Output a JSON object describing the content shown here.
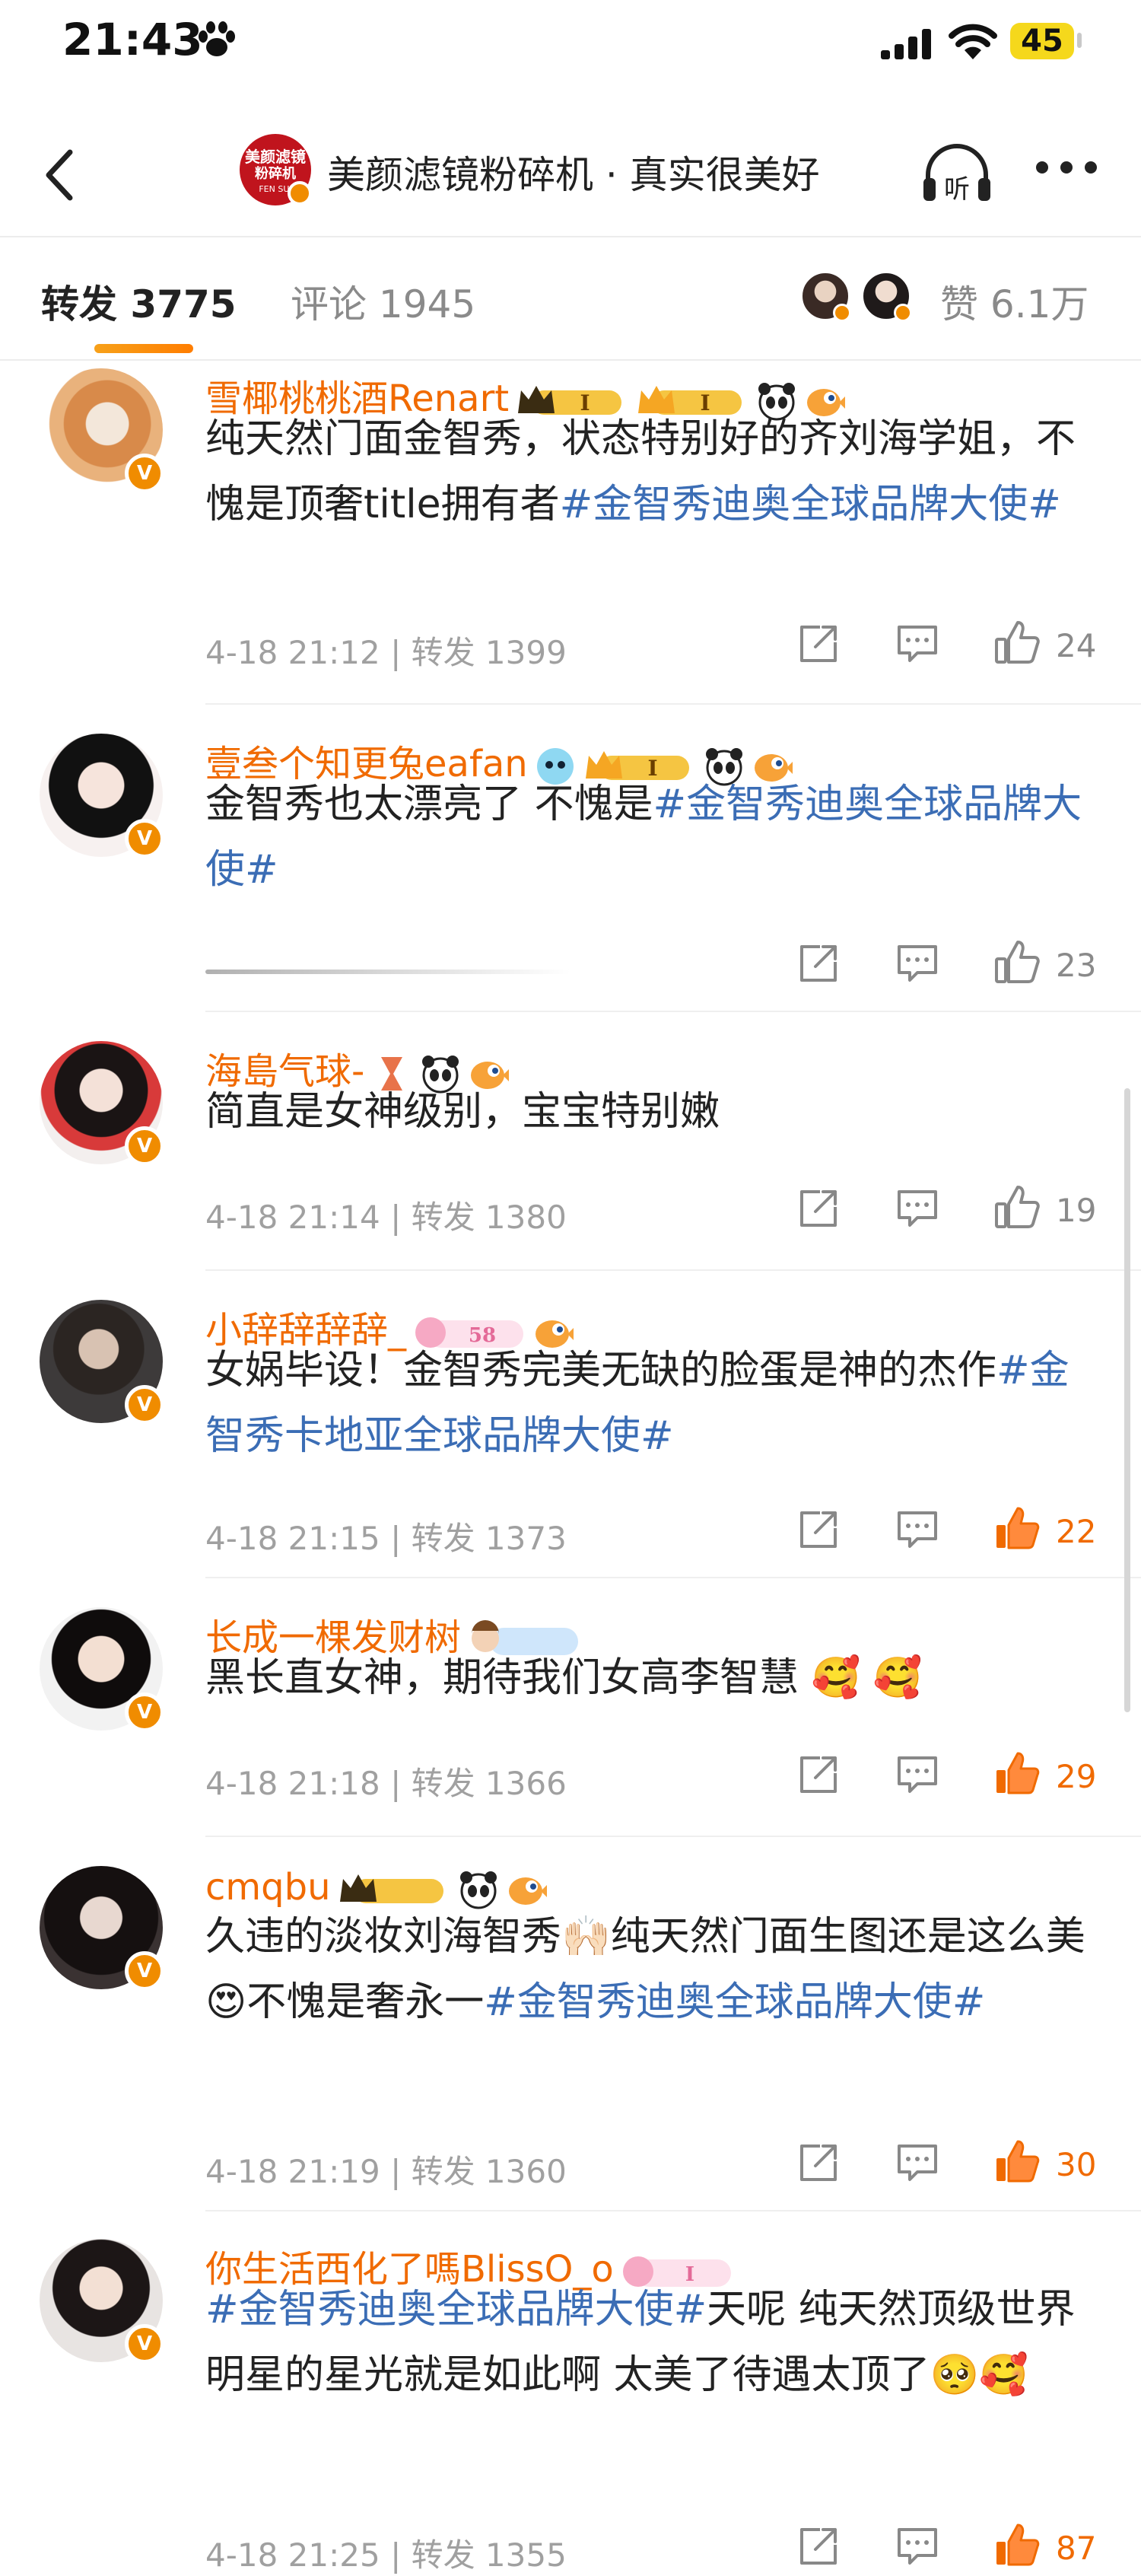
{
  "status": {
    "time": "21:43",
    "battery": "45"
  },
  "nav": {
    "avatar_line1": "美颜滤镜",
    "avatar_line2": "粉碎机",
    "avatar_line3": "FEN SUI",
    "title": "美颜滤镜粉碎机 · 真实很美好"
  },
  "tabs": {
    "repost": "转发 3775",
    "comments": "评论 1945",
    "likes": "赞 6.1万"
  },
  "comments": [
    {
      "user": "雪椰桃桃酒Renart",
      "badge_level": "I",
      "content_parts": [
        {
          "text": "纯天然门面金智秀，状态特别好的齐刘海学姐，不愧是顶奢title拥有者",
          "tag": false
        },
        {
          "text": "#金智秀迪奥全球品牌大使#",
          "tag": true
        }
      ],
      "time": "4-18 21:12",
      "repost": "转发 1399",
      "likes": "24",
      "liked": false
    },
    {
      "user": "壹叁个知更兔eafan",
      "badge_level": "I",
      "content_parts": [
        {
          "text": "金智秀也太漂亮了 不愧是",
          "tag": false
        },
        {
          "text": "#金智秀迪奥全球品牌大使#",
          "tag": true
        }
      ],
      "time": "",
      "repost": "",
      "likes": "23",
      "liked": false
    },
    {
      "user": "海島气球-",
      "badge_level": "",
      "content_parts": [
        {
          "text": "简直是女神级别，宝宝特别嫩",
          "tag": false
        }
      ],
      "time": "4-18 21:14",
      "repost": "转发 1380",
      "likes": "19",
      "liked": false
    },
    {
      "user": "小辞辞辞辞_",
      "badge_level": "58",
      "content_parts": [
        {
          "text": "女娲毕设！金智秀完美无缺的脸蛋是神的杰作",
          "tag": false
        },
        {
          "text": "#金智秀卡地亚全球品牌大使#",
          "tag": true
        }
      ],
      "time": "4-18 21:15",
      "repost": "转发 1373",
      "likes": "22",
      "liked": true
    },
    {
      "user": "长成一棵发财树",
      "badge_level": "",
      "content_parts": [
        {
          "text": "黑长直女神，期待我们女高李智慧 🥰 🥰",
          "tag": false
        }
      ],
      "time": "4-18 21:18",
      "repost": "转发 1366",
      "likes": "29",
      "liked": true
    },
    {
      "user": "cmqbu",
      "badge_level": "",
      "content_parts": [
        {
          "text": "久违的淡妆刘海智秀🙌🏻纯天然门面生图还是这么美😍不愧是奢永一",
          "tag": false
        },
        {
          "text": "#金智秀迪奥全球品牌大使#",
          "tag": true
        }
      ],
      "time": "4-18 21:19",
      "repost": "转发 1360",
      "likes": "30",
      "liked": true
    },
    {
      "user": "你生活西化了嗎BlissO_o",
      "badge_level": "I",
      "content_parts": [
        {
          "text": "#金智秀迪奥全球品牌大使#",
          "tag": true
        },
        {
          "text": "天呢 纯天然顶级世界明星的星光就是如此啊 太美了待遇太顶了🥺🥰",
          "tag": false
        }
      ],
      "time": "4-18 21:25",
      "repost": "转发 1355",
      "likes": "87",
      "liked": true
    }
  ],
  "icons": {
    "back": "chevron-left-icon",
    "listen": "headphones-icon",
    "more": "more-dots-icon",
    "share": "share-icon",
    "comment": "comment-icon",
    "like": "thumbs-up-icon"
  },
  "colors": {
    "accent": "#f06a00",
    "tag": "#3b6db5",
    "verify": "#f08c00"
  }
}
